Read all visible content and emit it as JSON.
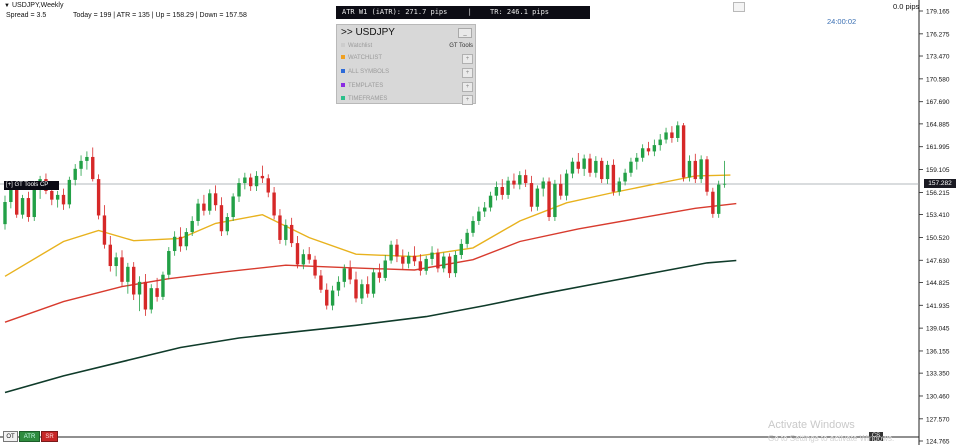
{
  "chart_data": {
    "type": "candlestick",
    "symbol_title": "USDJPY,Weekly",
    "spread": "Spread = 3.5",
    "stats": "Today = 199 | ATR = 135 | Up = 158.29 | Down = 157.58",
    "pips_label": "0.0 pips",
    "timer": "24:00:02",
    "current_price": "157.282",
    "y_ticks": [
      "179.165",
      "176.275",
      "173.470",
      "170.580",
      "167.690",
      "164.885",
      "161.995",
      "159.105",
      "156.215",
      "153.410",
      "150.520",
      "147.630",
      "144.825",
      "141.935",
      "139.045",
      "136.155",
      "133.350",
      "130.460",
      "127.570",
      "124.765"
    ],
    "ylim": [
      124.765,
      179.165
    ],
    "candles": [
      [
        152.2,
        155.8,
        151.5,
        155.0
      ],
      [
        155.0,
        157.6,
        154.2,
        156.8
      ],
      [
        156.8,
        157.4,
        153.0,
        153.4
      ],
      [
        153.4,
        155.9,
        152.9,
        155.5
      ],
      [
        155.5,
        156.3,
        152.5,
        153.1
      ],
      [
        153.1,
        157.0,
        152.6,
        156.6
      ],
      [
        156.6,
        158.3,
        155.4,
        157.9
      ],
      [
        157.9,
        158.6,
        156.0,
        156.4
      ],
      [
        156.4,
        157.0,
        154.6,
        155.3
      ],
      [
        155.3,
        156.4,
        154.3,
        155.9
      ],
      [
        155.9,
        156.7,
        154.0,
        154.7
      ],
      [
        154.7,
        158.2,
        154.2,
        157.8
      ],
      [
        157.8,
        159.8,
        157.1,
        159.2
      ],
      [
        159.2,
        160.9,
        158.3,
        160.2
      ],
      [
        160.2,
        161.4,
        159.1,
        160.7
      ],
      [
        160.7,
        161.9,
        157.6,
        157.9
      ],
      [
        157.9,
        158.5,
        152.8,
        153.3
      ],
      [
        153.3,
        154.6,
        149.1,
        149.6
      ],
      [
        149.6,
        150.7,
        146.2,
        146.9
      ],
      [
        146.9,
        148.6,
        145.6,
        148.0
      ],
      [
        148.0,
        148.9,
        144.3,
        144.9
      ],
      [
        144.9,
        147.3,
        143.4,
        146.8
      ],
      [
        146.8,
        147.4,
        142.6,
        143.3
      ],
      [
        143.3,
        145.6,
        141.2,
        144.9
      ],
      [
        144.9,
        145.9,
        140.6,
        141.4
      ],
      [
        141.4,
        144.6,
        140.9,
        144.1
      ],
      [
        144.1,
        145.4,
        142.4,
        143.0
      ],
      [
        143.0,
        146.2,
        142.6,
        145.8
      ],
      [
        145.8,
        149.3,
        145.2,
        148.8
      ],
      [
        148.8,
        151.3,
        148.2,
        150.6
      ],
      [
        150.6,
        151.8,
        148.7,
        149.4
      ],
      [
        149.4,
        151.7,
        148.9,
        151.2
      ],
      [
        151.2,
        153.2,
        150.7,
        152.6
      ],
      [
        152.6,
        155.4,
        152.0,
        154.8
      ],
      [
        154.8,
        155.9,
        153.3,
        153.9
      ],
      [
        153.9,
        156.6,
        153.4,
        156.1
      ],
      [
        156.1,
        157.1,
        153.9,
        154.6
      ],
      [
        154.6,
        155.6,
        150.7,
        151.3
      ],
      [
        151.3,
        153.6,
        150.8,
        153.1
      ],
      [
        153.1,
        156.1,
        152.6,
        155.7
      ],
      [
        155.7,
        158.0,
        155.0,
        157.4
      ],
      [
        157.4,
        158.7,
        156.6,
        158.1
      ],
      [
        158.1,
        158.6,
        156.4,
        157.0
      ],
      [
        157.0,
        158.9,
        156.4,
        158.3
      ],
      [
        158.3,
        159.6,
        157.4,
        158.0
      ],
      [
        158.0,
        158.5,
        155.6,
        156.2
      ],
      [
        156.2,
        156.9,
        152.8,
        153.3
      ],
      [
        153.3,
        154.1,
        149.7,
        150.2
      ],
      [
        150.2,
        152.8,
        149.5,
        152.1
      ],
      [
        152.1,
        153.0,
        149.3,
        149.8
      ],
      [
        149.8,
        150.7,
        146.6,
        147.1
      ],
      [
        147.1,
        149.0,
        146.5,
        148.4
      ],
      [
        148.4,
        149.3,
        147.2,
        147.7
      ],
      [
        147.7,
        148.2,
        145.3,
        145.7
      ],
      [
        145.7,
        146.4,
        143.5,
        143.9
      ],
      [
        143.9,
        144.7,
        141.4,
        141.9
      ],
      [
        141.9,
        144.4,
        141.3,
        143.8
      ],
      [
        143.8,
        145.6,
        143.1,
        144.9
      ],
      [
        144.9,
        147.1,
        144.2,
        146.6
      ],
      [
        146.6,
        147.6,
        144.6,
        145.2
      ],
      [
        145.2,
        146.2,
        142.3,
        142.8
      ],
      [
        142.8,
        145.2,
        142.1,
        144.6
      ],
      [
        144.6,
        145.6,
        142.9,
        143.4
      ],
      [
        143.4,
        146.6,
        142.9,
        146.1
      ],
      [
        146.1,
        147.2,
        144.8,
        145.4
      ],
      [
        145.4,
        148.3,
        145.0,
        147.6
      ],
      [
        147.6,
        150.1,
        147.2,
        149.6
      ],
      [
        149.6,
        150.3,
        147.4,
        148.1
      ],
      [
        148.1,
        149.0,
        146.5,
        147.2
      ],
      [
        147.2,
        148.7,
        146.6,
        148.2
      ],
      [
        148.2,
        149.4,
        146.9,
        147.5
      ],
      [
        147.5,
        148.4,
        145.7,
        146.3
      ],
      [
        146.3,
        148.2,
        145.8,
        147.8
      ],
      [
        147.8,
        149.4,
        147.0,
        148.6
      ],
      [
        148.6,
        149.1,
        146.1,
        146.6
      ],
      [
        146.6,
        148.6,
        146.1,
        148.1
      ],
      [
        148.1,
        148.5,
        145.4,
        146.0
      ],
      [
        146.0,
        148.8,
        145.5,
        148.3
      ],
      [
        148.3,
        150.3,
        147.8,
        149.7
      ],
      [
        149.7,
        151.6,
        149.2,
        151.1
      ],
      [
        151.1,
        153.2,
        150.6,
        152.6
      ],
      [
        152.6,
        154.4,
        152.1,
        153.8
      ],
      [
        153.8,
        155.0,
        153.1,
        154.3
      ],
      [
        154.3,
        156.3,
        153.8,
        155.8
      ],
      [
        155.8,
        157.6,
        155.2,
        156.9
      ],
      [
        156.9,
        157.9,
        155.3,
        155.9
      ],
      [
        155.9,
        158.2,
        155.4,
        157.7
      ],
      [
        157.7,
        158.6,
        156.7,
        157.2
      ],
      [
        157.2,
        158.9,
        156.6,
        158.4
      ],
      [
        158.4,
        159.1,
        156.9,
        157.4
      ],
      [
        157.4,
        158.3,
        153.8,
        154.4
      ],
      [
        154.4,
        157.1,
        153.9,
        156.7
      ],
      [
        156.7,
        158.1,
        155.7,
        157.6
      ],
      [
        157.6,
        158.1,
        152.6,
        153.1
      ],
      [
        153.1,
        157.8,
        152.6,
        157.3
      ],
      [
        157.3,
        158.5,
        155.3,
        155.8
      ],
      [
        155.8,
        159.1,
        155.2,
        158.6
      ],
      [
        158.6,
        160.6,
        158.0,
        160.1
      ],
      [
        160.1,
        161.2,
        158.6,
        159.2
      ],
      [
        159.2,
        161.0,
        158.3,
        160.5
      ],
      [
        160.5,
        161.1,
        158.2,
        158.7
      ],
      [
        158.7,
        160.8,
        158.1,
        160.2
      ],
      [
        160.2,
        160.6,
        157.4,
        157.9
      ],
      [
        157.9,
        160.2,
        157.3,
        159.7
      ],
      [
        159.7,
        160.4,
        155.8,
        156.3
      ],
      [
        156.3,
        158.1,
        155.8,
        157.6
      ],
      [
        157.6,
        159.2,
        157.1,
        158.7
      ],
      [
        158.7,
        160.6,
        158.2,
        160.1
      ],
      [
        160.1,
        161.2,
        159.1,
        160.6
      ],
      [
        160.6,
        162.3,
        160.1,
        161.8
      ],
      [
        161.8,
        162.6,
        160.9,
        161.4
      ],
      [
        161.4,
        162.9,
        160.8,
        162.2
      ],
      [
        162.2,
        163.6,
        161.5,
        162.9
      ],
      [
        162.9,
        164.4,
        162.4,
        163.8
      ],
      [
        163.8,
        164.6,
        162.5,
        163.1
      ],
      [
        163.1,
        165.2,
        162.6,
        164.7
      ],
      [
        164.7,
        165.0,
        157.6,
        158.1
      ],
      [
        158.1,
        160.9,
        157.6,
        160.2
      ],
      [
        160.2,
        161.1,
        157.4,
        157.9
      ],
      [
        157.9,
        160.9,
        157.4,
        160.4
      ],
      [
        160.4,
        160.8,
        155.8,
        156.3
      ],
      [
        156.3,
        156.8,
        153.0,
        153.5
      ],
      [
        153.5,
        157.7,
        153.0,
        157.2
      ],
      [
        157.2,
        160.2,
        156.8,
        157.3
      ]
    ],
    "ma_fast": [
      [
        0,
        145.6
      ],
      [
        10,
        150.0
      ],
      [
        16,
        151.4
      ],
      [
        22,
        150.1
      ],
      [
        30,
        150.4
      ],
      [
        36,
        152.3
      ],
      [
        44,
        153.4
      ],
      [
        52,
        150.5
      ],
      [
        60,
        148.4
      ],
      [
        70,
        148.1
      ],
      [
        80,
        149.2
      ],
      [
        88,
        152.6
      ],
      [
        96,
        154.9
      ],
      [
        104,
        156.2
      ],
      [
        112,
        157.4
      ],
      [
        118,
        158.3
      ],
      [
        124,
        158.4
      ]
    ],
    "ma_mid": [
      [
        0,
        139.8
      ],
      [
        10,
        142.4
      ],
      [
        20,
        144.3
      ],
      [
        28,
        145.3
      ],
      [
        38,
        146.2
      ],
      [
        48,
        147.0
      ],
      [
        58,
        146.7
      ],
      [
        70,
        146.4
      ],
      [
        80,
        147.7
      ],
      [
        88,
        150.0
      ],
      [
        98,
        151.6
      ],
      [
        108,
        152.9
      ],
      [
        118,
        154.2
      ],
      [
        125,
        154.8
      ]
    ],
    "ma_slow": [
      [
        0,
        130.9
      ],
      [
        10,
        133.0
      ],
      [
        20,
        134.8
      ],
      [
        30,
        136.6
      ],
      [
        40,
        137.8
      ],
      [
        50,
        138.6
      ],
      [
        60,
        139.4
      ],
      [
        72,
        140.5
      ],
      [
        82,
        141.9
      ],
      [
        92,
        143.4
      ],
      [
        102,
        144.8
      ],
      [
        112,
        146.2
      ],
      [
        120,
        147.3
      ],
      [
        125,
        147.6
      ]
    ],
    "colors": {
      "up": "#22a046",
      "down": "#d62828",
      "ma_fast": "#e8b21e",
      "ma_mid": "#d83b2e",
      "ma_slow": "#0f3b2a",
      "price_line": "#9aa0a6"
    }
  },
  "atr_bar": {
    "atr_text": "ATR W1 (iATR): 271.7 pips",
    "sep": "|",
    "tr_text": "TR: 246.1 pips"
  },
  "panel": {
    "title": ">> USDJPY",
    "collapse": "_",
    "rows": [
      {
        "label": "Watchlist",
        "color": "#cccccc",
        "right": "GT Tools"
      },
      {
        "label": "WATCHLIST",
        "color": "#f0a020",
        "right": "+"
      },
      {
        "label": "ALL SYMBOLS",
        "color": "#2c6ad8",
        "right": "+"
      },
      {
        "label": "TEMPLATES",
        "color": "#8a2be2",
        "right": "+"
      },
      {
        "label": "TIMEFRAMES",
        "color": "#2bbf8a",
        "right": "+"
      }
    ]
  },
  "cp_label": "[+] GT Tools CP",
  "bottom": {
    "ot": "OT",
    "atr": "ATR",
    "sr": "SR",
    "cs": "CS"
  },
  "watermark": {
    "line1": "Activate Windows",
    "line2": "Go to Settings to activate Windows."
  }
}
